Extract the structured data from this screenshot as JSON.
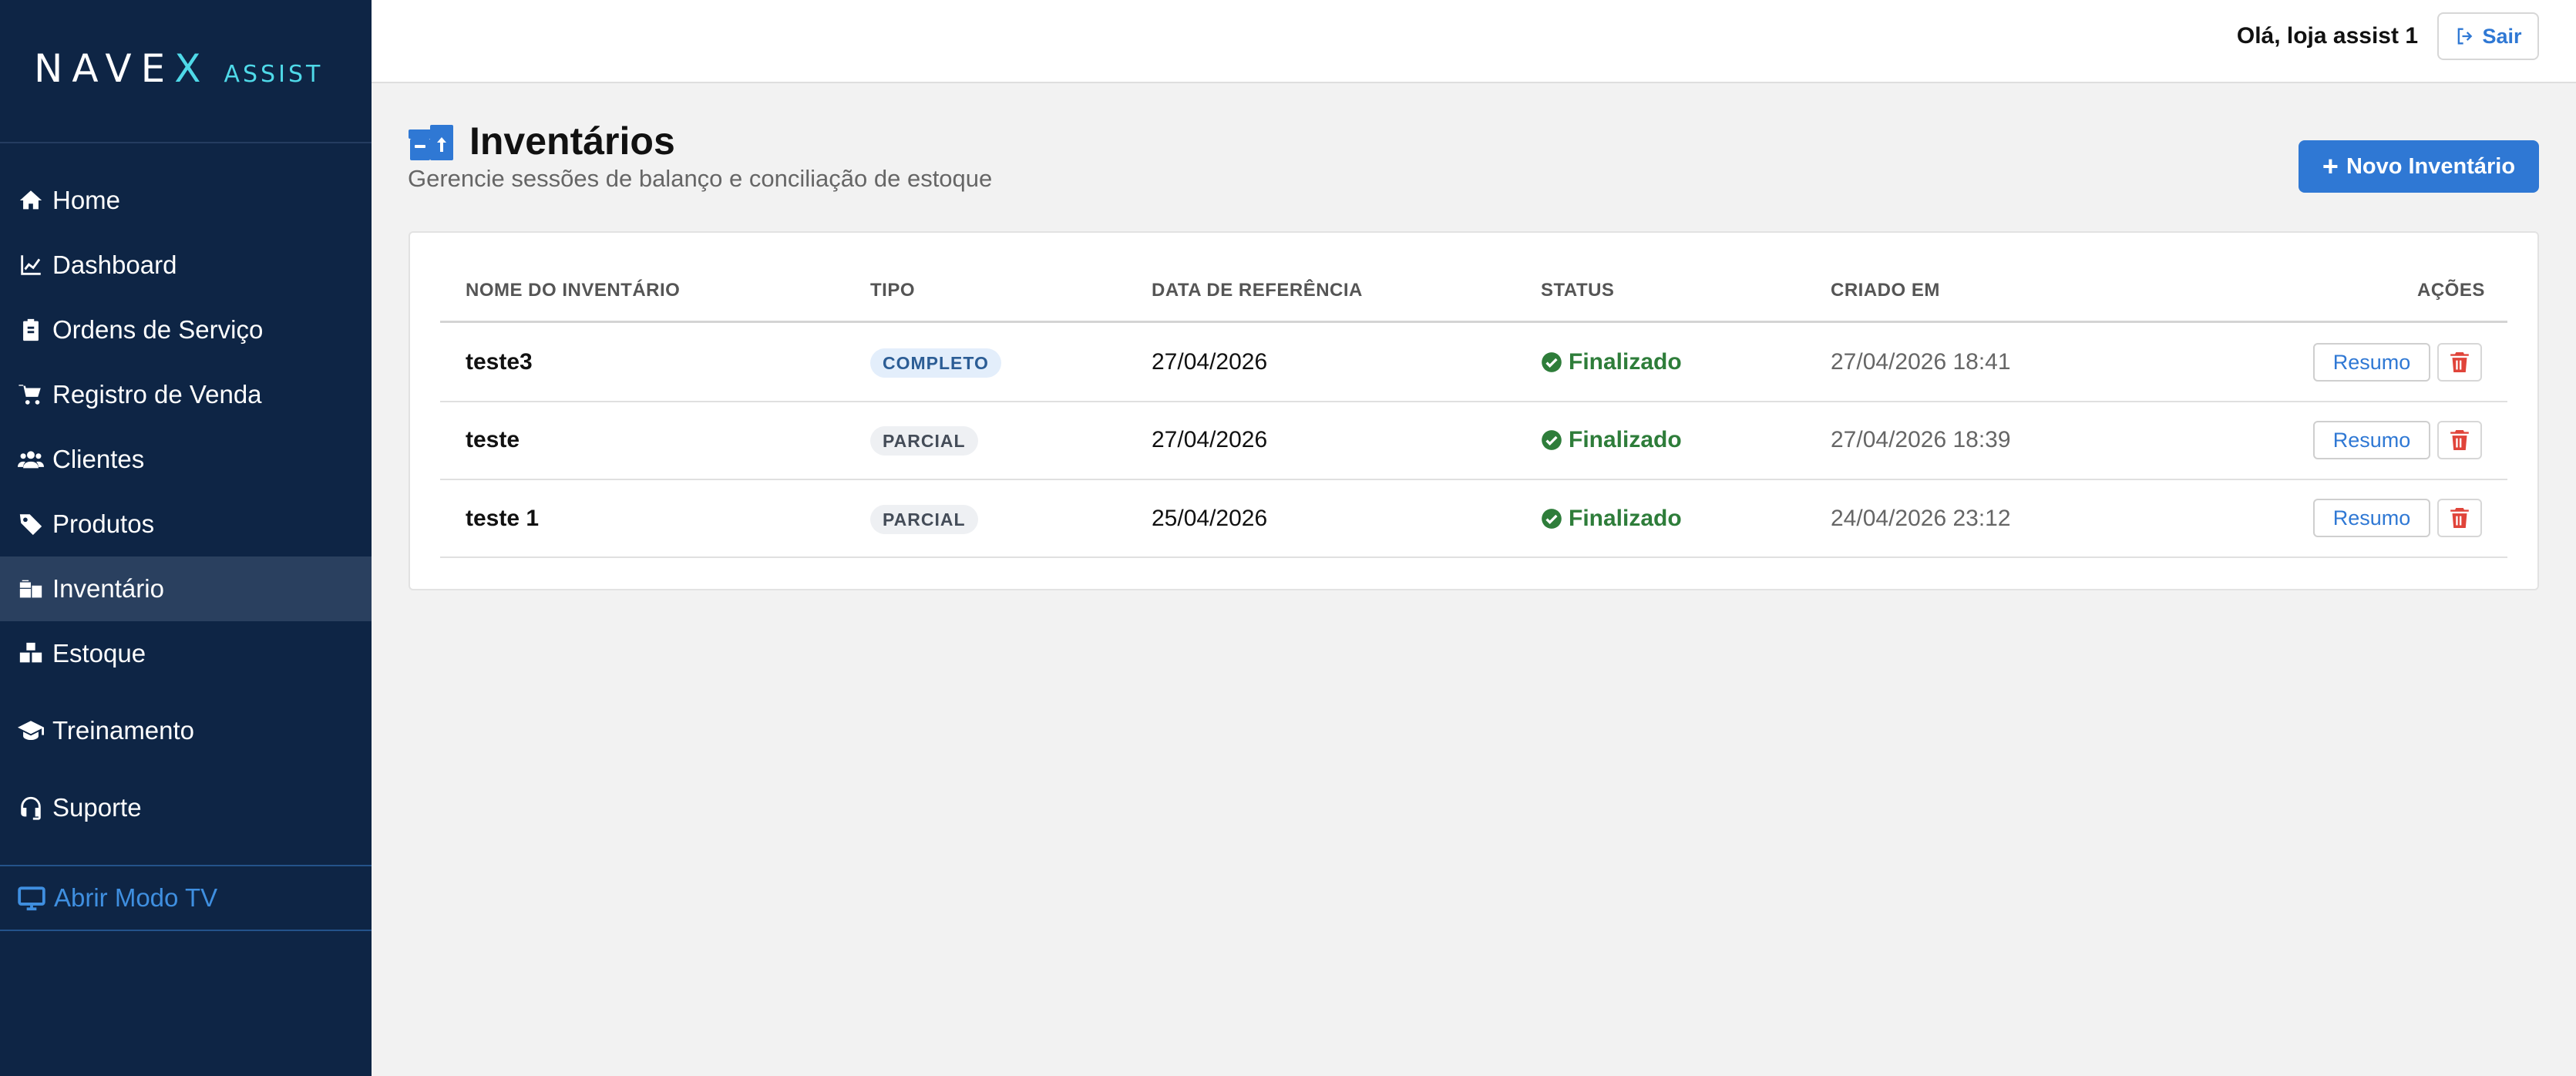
{
  "brand": {
    "logo_prefix": "NAVE",
    "logo_x": "X",
    "logo_sub": "ASSIST"
  },
  "sidebar": {
    "items": [
      {
        "label": "Home",
        "icon": "home-icon"
      },
      {
        "label": "Dashboard",
        "icon": "chart-line-icon"
      },
      {
        "label": "Ordens de Serviço",
        "icon": "clipboard-icon"
      },
      {
        "label": "Registro de Venda",
        "icon": "cart-icon"
      },
      {
        "label": "Clientes",
        "icon": "users-icon"
      },
      {
        "label": "Produtos",
        "icon": "tag-icon"
      },
      {
        "label": "Inventário",
        "icon": "boxes-icon",
        "active": true
      },
      {
        "label": "Estoque",
        "icon": "cubes-icon"
      },
      {
        "label": "Treinamento",
        "icon": "graduation-cap-icon"
      },
      {
        "label": "Suporte",
        "icon": "headset-icon"
      }
    ],
    "tv_mode": {
      "label": "Abrir Modo TV",
      "icon": "tv-icon"
    }
  },
  "header": {
    "greeting": "Olá, loja assist 1",
    "logout_label": "Sair"
  },
  "page": {
    "title": "Inventários",
    "subtitle": "Gerencie sessões de balanço e conciliação de estoque",
    "new_button": "Novo Inventário"
  },
  "table": {
    "columns": [
      "NOME DO INVENTÁRIO",
      "TIPO",
      "DATA DE REFERÊNCIA",
      "STATUS",
      "CRIADO EM",
      "AÇÕES"
    ],
    "rows": [
      {
        "name": "teste3",
        "type": "COMPLETO",
        "ref_date": "27/04/2026",
        "status": "Finalizado",
        "created": "27/04/2026 18:41",
        "action": "Resumo"
      },
      {
        "name": "teste",
        "type": "PARCIAL",
        "ref_date": "27/04/2026",
        "status": "Finalizado",
        "created": "27/04/2026 18:39",
        "action": "Resumo"
      },
      {
        "name": "teste 1",
        "type": "PARCIAL",
        "ref_date": "25/04/2026",
        "status": "Finalizado",
        "created": "24/04/2026 23:12",
        "action": "Resumo"
      }
    ]
  },
  "colors": {
    "sidebar_bg": "#0e2545",
    "accent": "#2f78d4",
    "brand_cyan": "#4fd9e8",
    "status_green": "#2e7d3a",
    "danger": "#e0443a"
  }
}
